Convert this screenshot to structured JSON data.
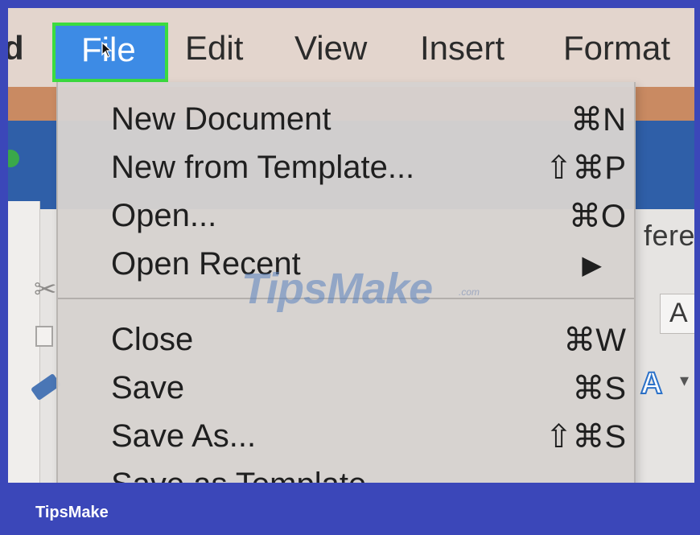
{
  "menubar": {
    "cut_item": "d",
    "file": "File",
    "edit": "Edit",
    "view": "View",
    "insert": "Insert",
    "format": "Format"
  },
  "file_menu": {
    "items": [
      {
        "label": "New Document",
        "shortcut": "⌘N"
      },
      {
        "label": "New from Template...",
        "shortcut": "⇧⌘P"
      },
      {
        "label": "Open...",
        "shortcut": "⌘O"
      },
      {
        "label": "Open Recent",
        "shortcut": "▶"
      },
      {
        "label": "Close",
        "shortcut": "⌘W"
      },
      {
        "label": "Save",
        "shortcut": "⌘S"
      },
      {
        "label": "Save As...",
        "shortcut": "⇧⌘S"
      },
      {
        "label": "Save as Template",
        "shortcut": ""
      }
    ]
  },
  "background": {
    "partial_text": "fere",
    "font_box_label": "A",
    "text_effects_label": "A",
    "chevron": "▾"
  },
  "watermark": {
    "text": "TipsMake",
    "suffix": ".com"
  },
  "brand": "TipsMake",
  "colors": {
    "border": "#3b47b9",
    "file_highlight": "#3d8be5",
    "highlight_outline": "#3bdc3f"
  }
}
